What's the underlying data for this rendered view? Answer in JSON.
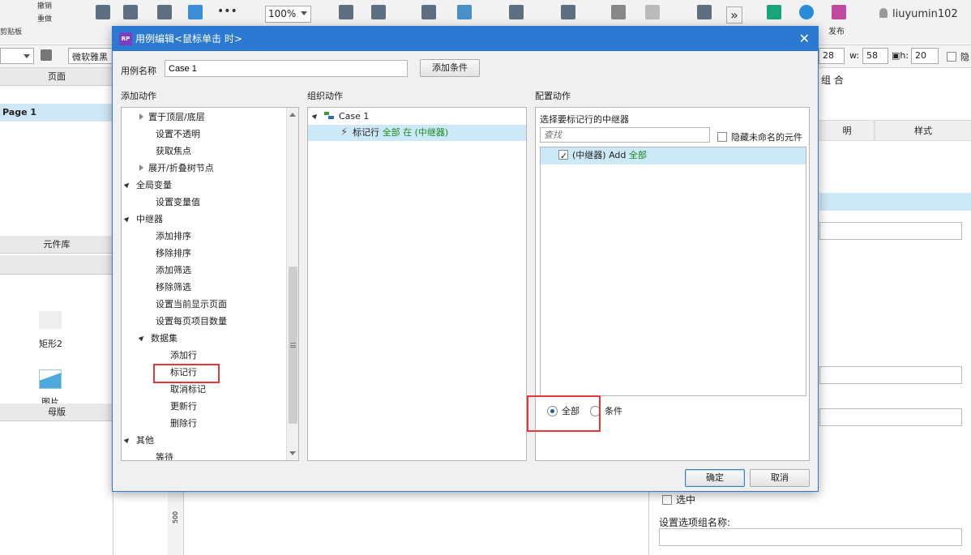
{
  "app": {
    "toolbar": {
      "undo": "撤销",
      "redo": "重做",
      "clipboard": "剪贴板",
      "zoom": "100%",
      "publish": "发布",
      "user": "liuyumin102"
    },
    "toolbar2": {
      "font": "微软雅黑",
      "y_value": "28",
      "w_label": "w:",
      "w_value": "58",
      "h_label": "h:",
      "h_value": "20",
      "hide_label": "隐"
    },
    "left_panel": {
      "pages_title": "页面",
      "page1": "Page 1",
      "widgets_title": "元件库",
      "rect2_label": "矩形2",
      "image_label": "图片",
      "masters_title": "母版"
    },
    "right_panel": {
      "group_label": "组 合",
      "tab_notes": "明",
      "tab_style": "样式",
      "selected_label": "选中",
      "radio_group_label": "设置选项组名称:"
    },
    "ruler_label": "500"
  },
  "dialog": {
    "title": "用例编辑<鼠标单击 时>",
    "case_name_label": "用例名称",
    "case_name_value": "Case 1",
    "add_condition": "添加条件",
    "col_add": "添加动作",
    "col_organize": "组织动作",
    "col_configure": "配置动作",
    "tree": [
      {
        "label": "置于顶层/底层",
        "level": 1,
        "twisty": "closed"
      },
      {
        "label": "设置不透明",
        "level": 1
      },
      {
        "label": "获取焦点",
        "level": 1
      },
      {
        "label": "展开/折叠树节点",
        "level": 1,
        "twisty": "closed"
      },
      {
        "label": "全局变量",
        "level": 0,
        "twisty": "open"
      },
      {
        "label": "设置变量值",
        "level": 1
      },
      {
        "label": "中继器",
        "level": 0,
        "twisty": "open"
      },
      {
        "label": "添加排序",
        "level": 1
      },
      {
        "label": "移除排序",
        "level": 1
      },
      {
        "label": "添加筛选",
        "level": 1
      },
      {
        "label": "移除筛选",
        "level": 1
      },
      {
        "label": "设置当前显示页面",
        "level": 1
      },
      {
        "label": "设置每页项目数量",
        "level": 1
      },
      {
        "label": "数据集",
        "level": 1,
        "twisty": "open"
      },
      {
        "label": "添加行",
        "level": 2
      },
      {
        "label": "标记行",
        "level": 2
      },
      {
        "label": "取消标记",
        "level": 2
      },
      {
        "label": "更新行",
        "level": 2
      },
      {
        "label": "删除行",
        "level": 2
      },
      {
        "label": "其他",
        "level": 0,
        "twisty": "open"
      },
      {
        "label": "等待",
        "level": 1
      }
    ],
    "organize": {
      "case_label": "Case 1",
      "action_prefix": "标记行",
      "action_target": "全部 在 (中继器)"
    },
    "configure": {
      "select_repeater_label": "选择要标记行的中继器",
      "search_placeholder": "查找",
      "hide_unnamed": "隐藏未命名的元件",
      "repeater_item_prefix": "(中继器) Add",
      "repeater_item_suffix": "全部",
      "radio_all": "全部",
      "radio_condition": "条件"
    },
    "ok": "确定",
    "cancel": "取消"
  }
}
